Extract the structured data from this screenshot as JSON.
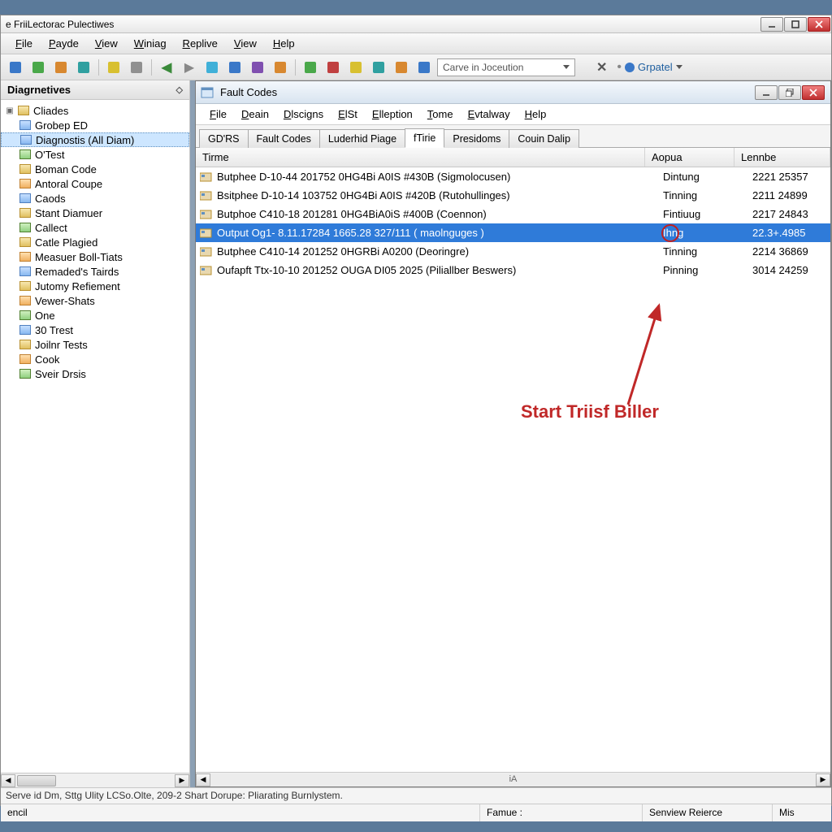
{
  "outer": {
    "title": "e FriiLectorac Pulectiwes"
  },
  "menu": {
    "items": [
      "File",
      "Payde",
      "View",
      "Winiag",
      "Replive",
      "View",
      "Help"
    ]
  },
  "toolbar": {
    "search_placeholder": "Carve in Joceution",
    "right_label": "Grpatel"
  },
  "sidebar": {
    "title": "Diagrnetives",
    "root": "Cliades",
    "items": [
      "Grobep ED",
      "Diagnostis (All Diam)",
      "O'Test",
      "Boman Code",
      "Antoral Coupe",
      "Caods",
      "Stant Diamuer",
      "Callect",
      "Catle Plagied",
      "Measuer Boll-Tiats",
      "Remaded's Tairds",
      "Jutomy Refiement",
      "Vewer-Shats",
      "One",
      "30 Trest",
      "Joilnr Tests",
      "Cook",
      "Sveir Drsis"
    ],
    "selected_index": 1
  },
  "child": {
    "title": "Fault Codes",
    "menu": [
      "File",
      "Deain",
      "Dlscigns",
      "ElSt",
      "Elleption",
      "Tome",
      "Evtalway",
      "Help"
    ],
    "tabs": [
      "GD'RS",
      "Fault Codes",
      "Luderhid Piage",
      "fTirie",
      "Presidoms",
      "Couin Dalip"
    ],
    "active_tab": 3,
    "columns": [
      "Tirme",
      "Aopua",
      "Lennbe"
    ],
    "rows": [
      {
        "name": "Butphee D-10-44 201752 0HG4Bi A0IS #430B (Sigmolocusen)",
        "a": "Dintung",
        "b": "2221 25357"
      },
      {
        "name": "Bsitphee D-10-14 103752 0HG4Bi A0IS #420B (Rutohullinges)",
        "a": "Tinning",
        "b": "2211 24899"
      },
      {
        "name": "Butphoe C410-18 201281 0HG4BiA0iS #400B (Coennon)",
        "a": "Fintiuug",
        "b": "2217 24843"
      },
      {
        "name": "Output Og1- 8.11.17284 1665.28  327/111 ( maolnguges )",
        "a": "Ihng",
        "b": "22.3+.4985"
      },
      {
        "name": "Butphee C410-14 201252 0HGRBi A0200 (Deoringre)",
        "a": "Tinning",
        "b": "2214 36869"
      },
      {
        "name": "Oufapft Ttx-10-10 201252 OUGA DI05 2025 (Piliallber Beswers)",
        "a": "Pinning",
        "b": "3014 24259"
      }
    ],
    "selected_row": 3,
    "hscroll_label": "iA"
  },
  "annotation": {
    "label": "Start Triisf Biller"
  },
  "status": {
    "line1": "Serve id Dm, Sttg Ulity LCSo.Olte, 209-2 Shart Dorupe: Pliarating Burnlystem.",
    "cells": [
      "encil",
      "Famue :",
      "Senview Reierce",
      "Mis"
    ]
  }
}
